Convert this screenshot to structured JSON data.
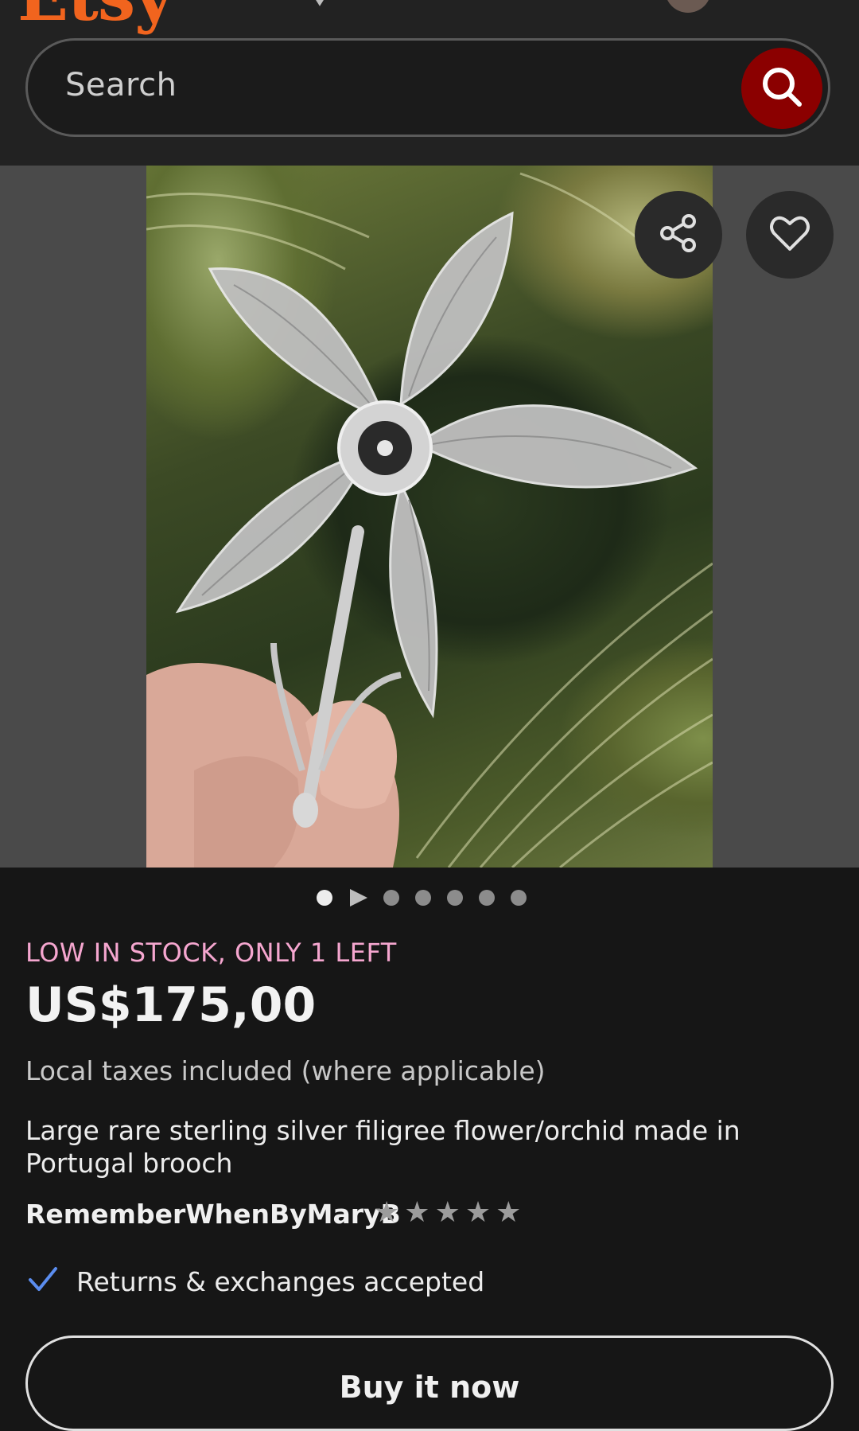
{
  "header": {
    "logo": "Etsy",
    "logo_color": "#f1641e",
    "icons": [
      "favorites-icon",
      "gift-icon",
      "notifications-icon",
      "shop-icon",
      "account-avatar",
      "cart-icon"
    ]
  },
  "search": {
    "placeholder": "Search",
    "button_icon": "search-icon",
    "button_color": "#8b0000"
  },
  "gallery": {
    "image_alt": "Silver filigree orchid brooch held between fingers in front of green striped leaves",
    "actions": [
      "share-icon",
      "heart-icon"
    ],
    "dot_count": 7,
    "active_dot": 0
  },
  "listing": {
    "stock_notice": "LOW IN STOCK, ONLY 1 LEFT",
    "stock_color": "#f5a6cf",
    "price": "US$175,00",
    "tax_note": "Local taxes included (where applicable)",
    "title": "Large rare sterling silver filigree flower/orchid made in Portugal brooch",
    "shop_name": "RememberWhenByMaryB",
    "rating_stars": 5,
    "returns": "Returns & exchanges accepted",
    "buy_label": "Buy it now"
  }
}
